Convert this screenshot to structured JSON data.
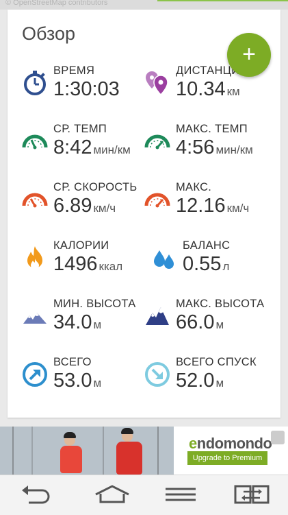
{
  "map": {
    "credit": "© OpenStreetMap contributors"
  },
  "card": {
    "title": "Обзор",
    "fab_label": "+"
  },
  "stats": {
    "time": {
      "label": "ВРЕМЯ",
      "value": "1:30:03",
      "unit": ""
    },
    "distance": {
      "label": "ДИСТАНЦИЯ",
      "value": "10.34",
      "unit": "км"
    },
    "avg_pace": {
      "label": "СР. ТЕМП",
      "value": "8:42",
      "unit": "мин/км"
    },
    "max_pace": {
      "label": "МАКС. ТЕМП",
      "value": "4:56",
      "unit": "мин/км"
    },
    "avg_speed": {
      "label": "СР. СКОРОСТЬ",
      "value": "6.89",
      "unit": "км/ч"
    },
    "max_speed": {
      "label": "МАКС.",
      "value": "12.16",
      "unit": "км/ч"
    },
    "calories": {
      "label": "КАЛОРИИ",
      "value": "1496",
      "unit": "ккал"
    },
    "balance": {
      "label": "БАЛАНС",
      "value": "0.55",
      "unit": "л"
    },
    "min_alt": {
      "label": "МИН. ВЫСОТА",
      "value": "34.0",
      "unit": "м"
    },
    "max_alt": {
      "label": "МАКС. ВЫСОТА",
      "value": "66.0",
      "unit": "м"
    },
    "ascent": {
      "label": "ВСЕГО",
      "value": "53.0",
      "unit": "м"
    },
    "descent": {
      "label": "ВСЕГО СПУСК",
      "value": "52.0",
      "unit": "м"
    }
  },
  "ad": {
    "logo_prefix": "e",
    "logo_rest": "ndomondo",
    "cta": "Upgrade to Premium"
  },
  "icons": {
    "time": "stopwatch-icon",
    "distance": "map-pins-icon",
    "avg_pace": "gauge-icon",
    "max_pace": "gauge-icon",
    "avg_speed": "speedometer-icon",
    "max_speed": "speedometer-icon",
    "calories": "flame-icon",
    "balance": "water-drops-icon",
    "min_alt": "mountain-icon",
    "max_alt": "mountain-icon",
    "ascent": "arrow-up-right-icon",
    "descent": "arrow-down-right-icon"
  },
  "colors": {
    "accent": "#7dac25",
    "time": "#2f4f8f",
    "distance": "#9b3fa0",
    "pace": "#1e8a5a",
    "speed": "#e2532a",
    "calories": "#f29a1b",
    "balance": "#2f8fd6",
    "alt_min": "#6b7bb7",
    "alt_max": "#2f3f86",
    "ascent": "#2d8fcd",
    "descent": "#7ecbe0"
  }
}
